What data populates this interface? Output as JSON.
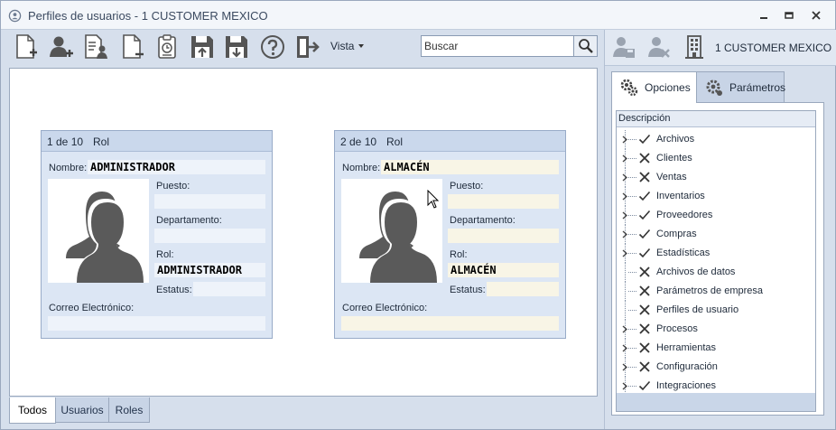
{
  "window": {
    "title": "Perfiles de usuarios - 1 CUSTOMER MEXICO"
  },
  "toolbar": {
    "buttons": [
      {
        "name": "new-document-icon"
      },
      {
        "name": "add-user-icon"
      },
      {
        "name": "user-list-icon"
      },
      {
        "name": "remove-document-icon"
      },
      {
        "name": "clipboard-timer-icon"
      },
      {
        "name": "save-upload-icon"
      },
      {
        "name": "save-download-icon"
      },
      {
        "name": "help-icon"
      },
      {
        "name": "exit-icon"
      }
    ],
    "view_label": "Vista",
    "search_placeholder": "Buscar"
  },
  "cards": [
    {
      "index": "1 de 10",
      "role_header": "Rol",
      "name_label": "Nombre:",
      "name": "ADMINISTRADOR",
      "position_label": "Puesto:",
      "position": "",
      "department_label": "Departamento:",
      "department": "",
      "role_label": "Rol:",
      "role": "ADMINISTRADOR",
      "status_label": "Estatus:",
      "status": "",
      "email_label": "Correo Electrónico:",
      "email": ""
    },
    {
      "index": "2 de 10",
      "role_header": "Rol",
      "name_label": "Nombre:",
      "name": "ALMACÉN",
      "position_label": "Puesto:",
      "position": "",
      "department_label": "Departamento:",
      "department": "",
      "role_label": "Rol:",
      "role": "ALMACÉN",
      "status_label": "Estatus:",
      "status": "",
      "email_label": "Correo Electrónico:",
      "email": ""
    }
  ],
  "bottom_tabs": [
    {
      "label": "Todos",
      "active": true
    },
    {
      "label": "Usuarios",
      "active": false
    },
    {
      "label": "Roles",
      "active": false
    }
  ],
  "right_panel": {
    "company": "1 CUSTOMER MEXICO",
    "tabs": [
      {
        "label": "Opciones",
        "active": true
      },
      {
        "label": "Parámetros",
        "active": false
      }
    ],
    "grid_header": "Descripción",
    "options": [
      {
        "label": "Archivos",
        "state": "check",
        "expandable": true
      },
      {
        "label": "Clientes",
        "state": "cross",
        "expandable": true
      },
      {
        "label": "Ventas",
        "state": "cross",
        "expandable": true
      },
      {
        "label": "Inventarios",
        "state": "check",
        "expandable": true
      },
      {
        "label": "Proveedores",
        "state": "check",
        "expandable": true
      },
      {
        "label": "Compras",
        "state": "check",
        "expandable": true
      },
      {
        "label": "Estadísticas",
        "state": "check",
        "expandable": true
      },
      {
        "label": "Archivos de datos",
        "state": "cross",
        "expandable": false
      },
      {
        "label": "Parámetros de empresa",
        "state": "cross",
        "expandable": false
      },
      {
        "label": "Perfiles de usuario",
        "state": "cross",
        "expandable": false
      },
      {
        "label": "Procesos",
        "state": "cross",
        "expandable": true
      },
      {
        "label": "Herramientas",
        "state": "cross",
        "expandable": true
      },
      {
        "label": "Configuración",
        "state": "cross",
        "expandable": true
      },
      {
        "label": "Integraciones",
        "state": "check",
        "expandable": true
      }
    ]
  }
}
